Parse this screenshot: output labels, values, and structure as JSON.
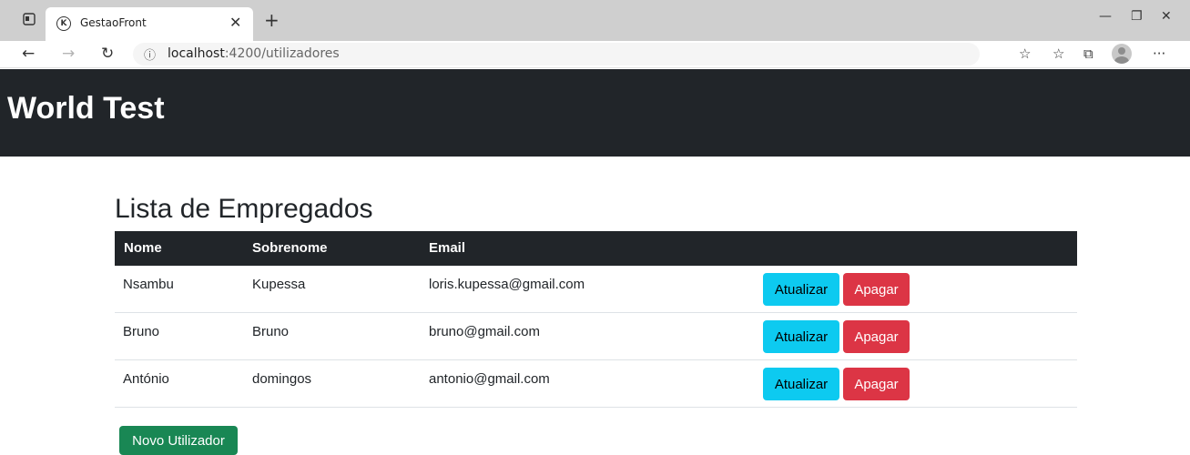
{
  "browser": {
    "tab_title": "GestaoFront",
    "tab_favicon_letter": "K",
    "url_host": "localhost",
    "url_path": ":4200/utilizadores",
    "icons": {
      "sidebar": "tab-sidebar-icon",
      "close": "close-icon",
      "new_tab": "plus-icon",
      "minimize": "minimize-icon",
      "restore": "restore-icon",
      "window_close": "window-close-icon",
      "back": "back-arrow-icon",
      "forward": "forward-arrow-icon",
      "refresh": "refresh-icon",
      "info": "info-icon",
      "favorites_add": "star-add-icon",
      "favorites": "favorites-icon",
      "collections": "collections-icon",
      "profile": "avatar-icon",
      "menu": "more-icon"
    }
  },
  "navbar": {
    "brand": "World Test",
    "background": "#212529"
  },
  "main": {
    "title": "Lista de Empregados",
    "table": {
      "headers": [
        "Nome",
        "Sobrenome",
        "Email"
      ],
      "rows": [
        {
          "nome": "Nsambu",
          "sobrenome": "Kupessa",
          "email": "loris.kupessa@gmail.com",
          "update": "Atualizar",
          "delete": "Apagar"
        },
        {
          "nome": "Bruno",
          "sobrenome": "Bruno",
          "email": "bruno@gmail.com",
          "update": "Atualizar",
          "delete": "Apagar"
        },
        {
          "nome": "António",
          "sobrenome": "domingos",
          "email": "antonio@gmail.com",
          "update": "Atualizar",
          "delete": "Apagar"
        }
      ]
    },
    "new_button": "Novo Utilizador"
  },
  "colors": {
    "info": "#0dcaf0",
    "danger": "#dc3545",
    "success": "#198754",
    "dark": "#212529"
  }
}
